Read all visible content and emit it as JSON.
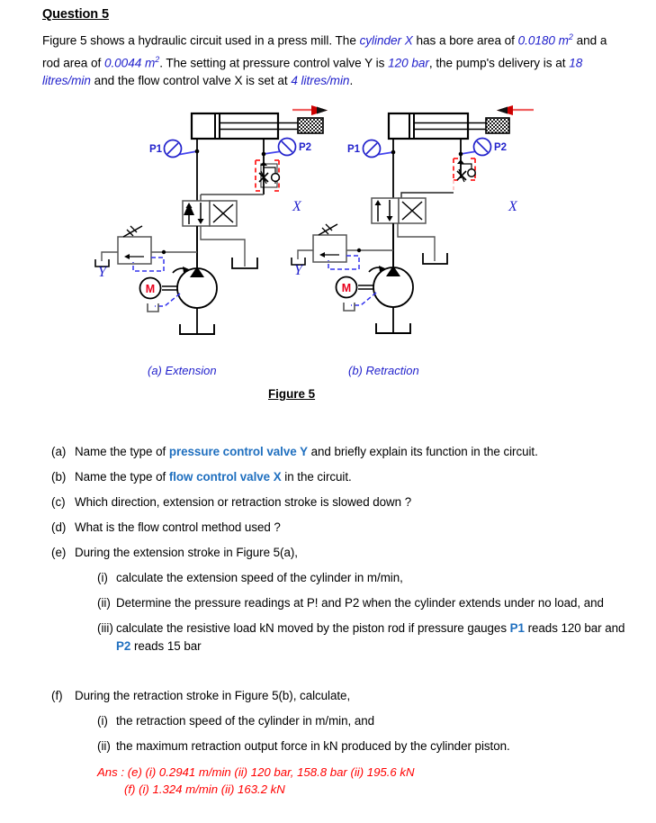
{
  "heading": "Question 5",
  "intro": {
    "seg1": "Figure 5 shows a hydraulic circuit used in a press mill. The ",
    "em1": "cylinder X",
    "seg2": " has a bore area of ",
    "em2": "0.0180 m",
    "em2sup": "2",
    "seg3": " and a rod area of ",
    "em3": "0.0044 m",
    "em3sup": "2",
    "seg4": ". The setting at pressure control valve Y is ",
    "em4": "120 bar",
    "seg5": ", the pump's delivery is at ",
    "em5": "18 litres/min",
    "seg6": " and the flow control valve X is set at ",
    "em6": "4 litres/min",
    "seg7": "."
  },
  "figure": {
    "caption_a": "(a) Extension",
    "caption_b": "(b) Retraction",
    "caption": "Figure 5",
    "gauge_p1": "P1",
    "gauge_p2": "P2",
    "valve_x_label": "X",
    "valve_y_label": "Y",
    "motor_label": "M",
    "colors": {
      "line": "#000000",
      "blue": "#2222cc",
      "red": "#ff0000",
      "gray": "#555555",
      "motor_red": "#e8001c"
    }
  },
  "questions": [
    {
      "label": "(a)",
      "parts": [
        {
          "t": "Name the type of ",
          "s": "plain"
        },
        {
          "t": "pressure control valve Y",
          "s": "blue"
        },
        {
          "t": " and briefly explain its function in the circuit.",
          "s": "plain"
        }
      ]
    },
    {
      "label": "(b)",
      "parts": [
        {
          "t": "Name the type of ",
          "s": "plain"
        },
        {
          "t": "flow control valve X",
          "s": "blue"
        },
        {
          "t": " in the circuit.",
          "s": "plain"
        }
      ]
    },
    {
      "label": "(c)",
      "parts": [
        {
          "t": "Which direction, extension or retraction stroke is slowed down ?",
          "s": "plain"
        }
      ]
    },
    {
      "label": "(d)",
      "parts": [
        {
          "t": "What is the flow control method used ?",
          "s": "plain"
        }
      ]
    },
    {
      "label": "(e)",
      "parts": [
        {
          "t": "During the extension stroke in Figure 5(a),",
          "s": "plain"
        }
      ]
    },
    {
      "label": "(f)",
      "parts": [
        {
          "t": "During the retraction stroke in Figure 5(b), calculate,",
          "s": "plain"
        }
      ]
    }
  ],
  "subquestions_e": [
    {
      "label": "(i)",
      "parts": [
        {
          "t": "calculate the extension speed of the cylinder in m/min,",
          "s": "plain"
        }
      ]
    },
    {
      "label": "(ii)",
      "parts": [
        {
          "t": "Determine the pressure readings at P! and P2 when the cylinder extends under no load, and",
          "s": "plain"
        }
      ]
    },
    {
      "label": "(iii)",
      "parts": [
        {
          "t": "calculate the resistive load kN moved by the piston rod if pressure gauges ",
          "s": "plain"
        },
        {
          "t": "P1",
          "s": "blue"
        },
        {
          "t": " reads 120 bar and ",
          "s": "plain"
        },
        {
          "t": "P2",
          "s": "blue"
        },
        {
          "t": " reads 15 bar",
          "s": "plain"
        }
      ]
    }
  ],
  "subquestions_f": [
    {
      "label": "(i)",
      "parts": [
        {
          "t": "the retraction speed of the cylinder in m/min, and",
          "s": "plain"
        }
      ]
    },
    {
      "label": "(ii)",
      "parts": [
        {
          "t": "the maximum retraction output force in kN produced by the cylinder piston.",
          "s": "plain"
        }
      ]
    }
  ],
  "answer": {
    "line1": "Ans : (e) (i) 0.2941 m/min (ii) 120 bar, 158.8 bar (ii) 195.6 kN",
    "line2": "(f) (i) 1.324 m/min (ii) 163.2 kN"
  }
}
